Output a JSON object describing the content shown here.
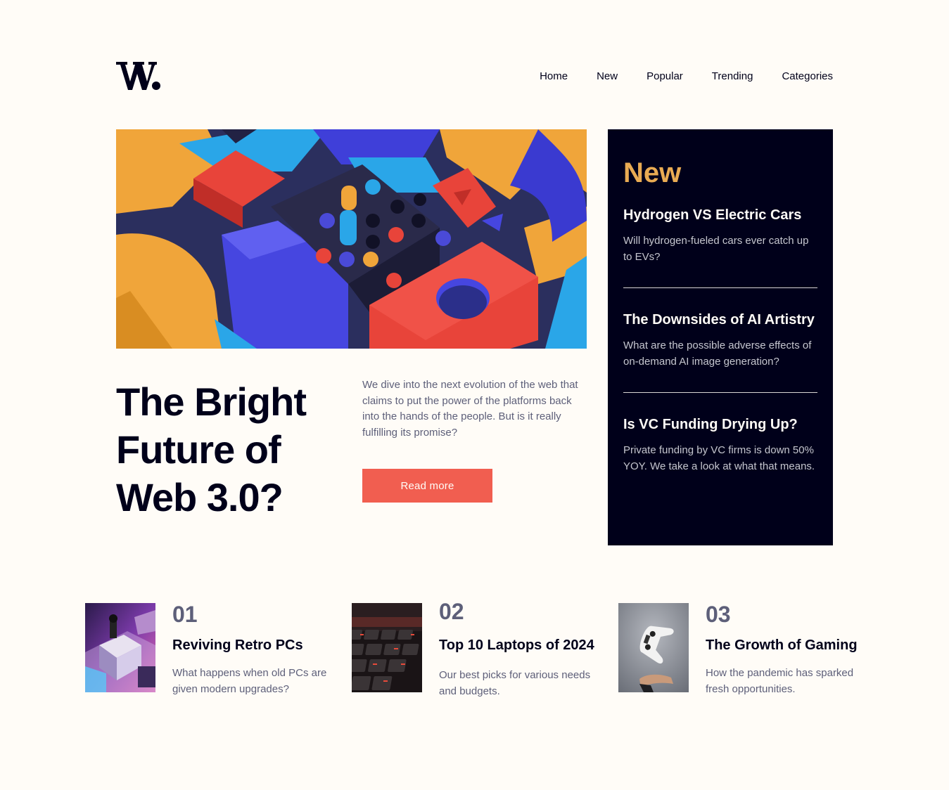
{
  "logo": {
    "text": "W."
  },
  "nav": {
    "items": [
      "Home",
      "New",
      "Popular",
      "Trending",
      "Categories"
    ]
  },
  "hero": {
    "title": "The Bright Future of Web 3.0?",
    "description": "We dive into the next evolution of the web that claims to put the power of the platforms back into the hands of the people. But is it really fulfilling its promise?",
    "button_label": "Read more"
  },
  "new_panel": {
    "heading": "New",
    "items": [
      {
        "title": "Hydrogen VS Electric Cars",
        "description": "Will hydrogen-fueled cars ever catch up to EVs?"
      },
      {
        "title": "The Downsides of AI Artistry",
        "description": "What are the possible adverse effects of on-demand AI image generation?"
      },
      {
        "title": "Is VC Funding Drying Up?",
        "description": "Private funding by VC firms is down 50% YOY. We take a look at what that means."
      }
    ]
  },
  "cards": [
    {
      "number": "01",
      "title": "Reviving Retro PCs",
      "description": "What happens when old PCs are given modern upgrades?"
    },
    {
      "number": "02",
      "title": "Top 10 Laptops of 2024",
      "description": "Our best picks for various needs and budgets."
    },
    {
      "number": "03",
      "title": "The Growth of Gaming",
      "description": "How the pandemic has sparked fresh opportunities."
    }
  ],
  "colors": {
    "background": "#fffcf7",
    "dark_navy": "#00001a",
    "accent_red": "#f15e50",
    "accent_orange": "#e9ab53",
    "grayish_blue": "#5d5f79"
  }
}
